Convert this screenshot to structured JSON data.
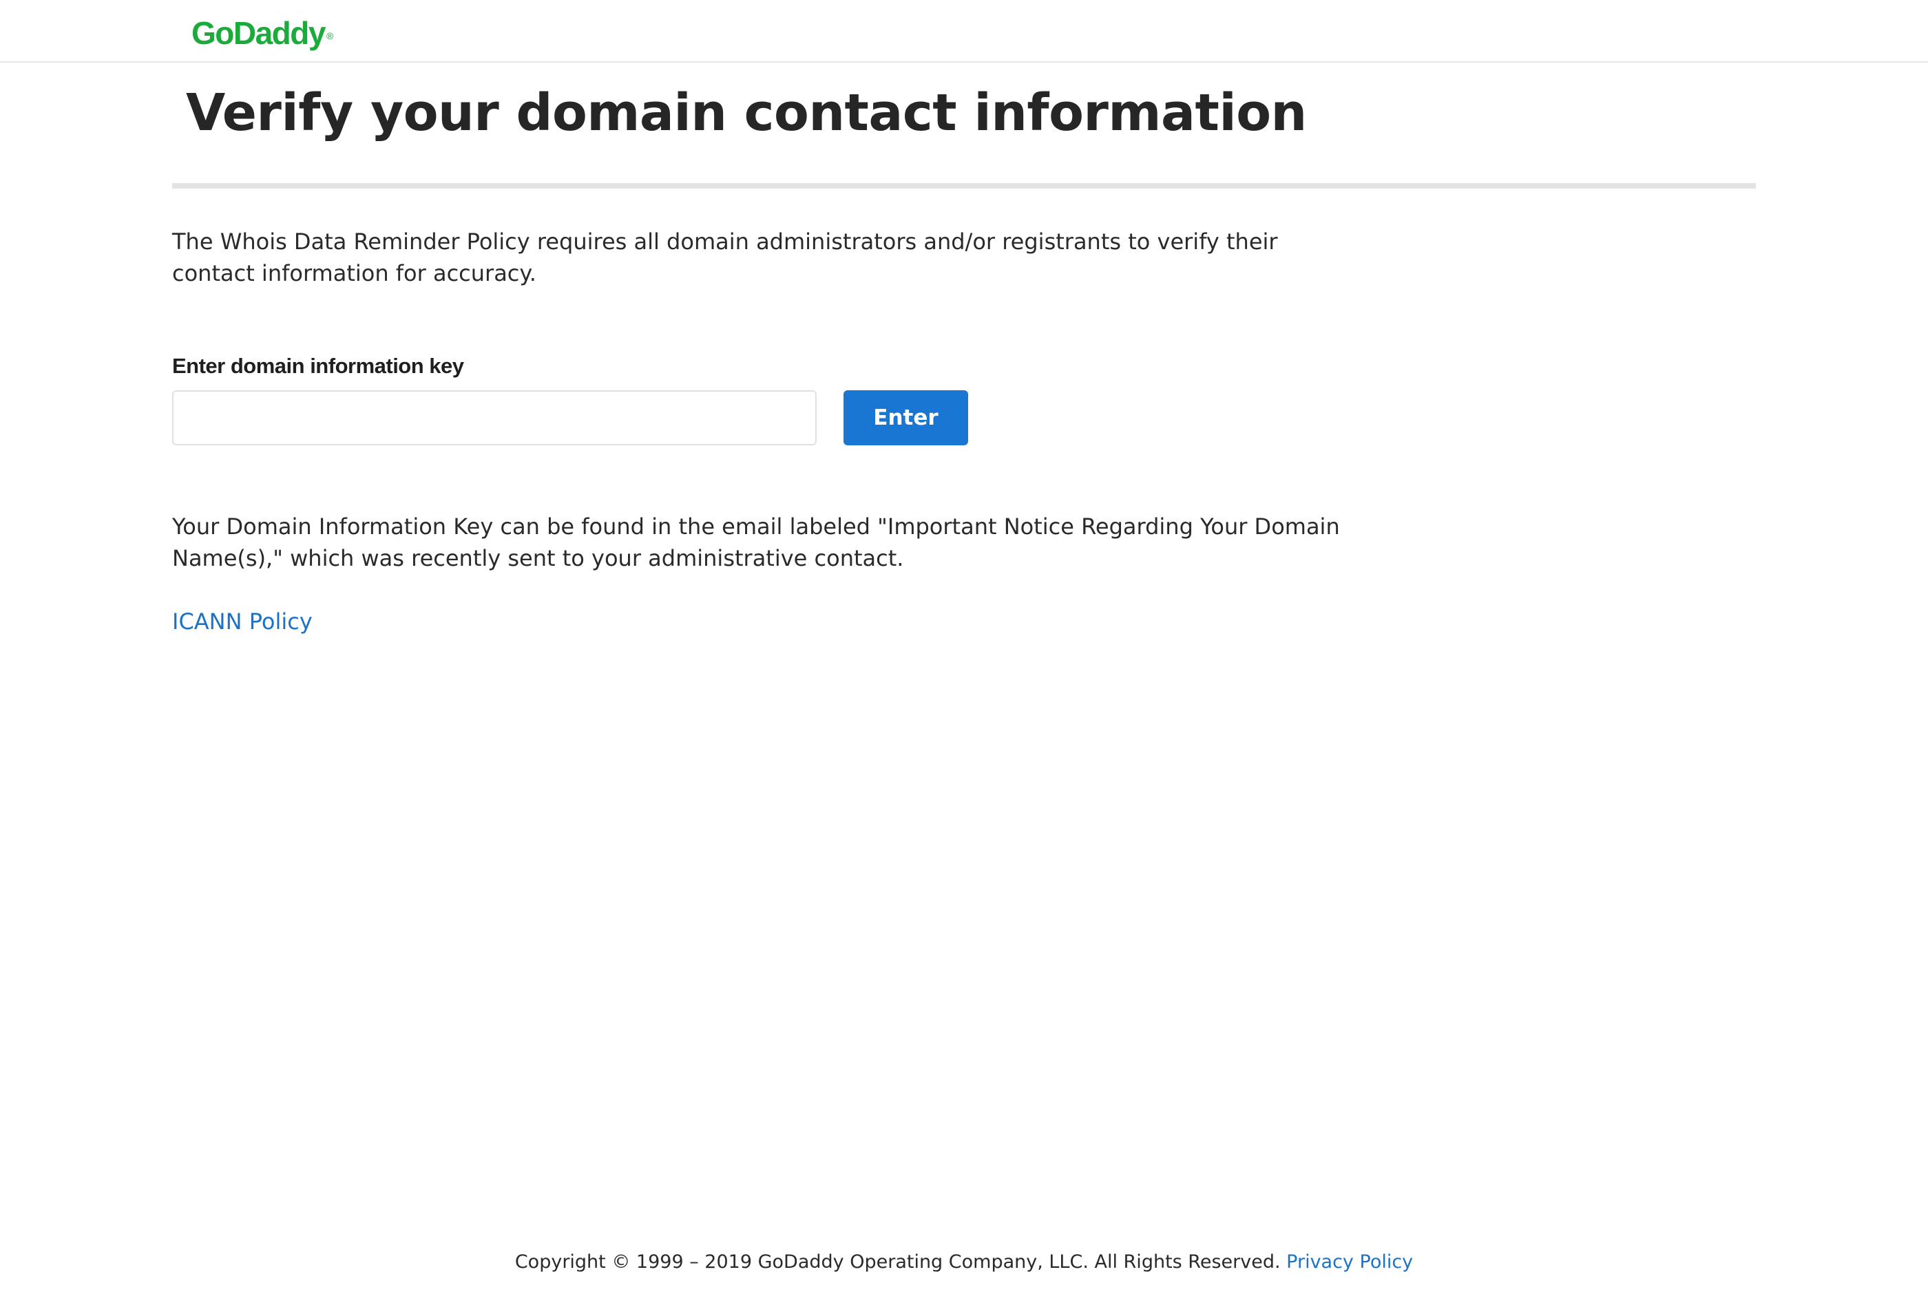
{
  "header": {
    "logo_text": "GoDaddy",
    "logo_mark": "®"
  },
  "main": {
    "title": "Verify your domain contact information",
    "intro": "The Whois Data Reminder Policy requires all domain administrators and/or registrants to verify their contact information for accuracy.",
    "key_field": {
      "label": "Enter domain information key",
      "value": "",
      "placeholder": ""
    },
    "enter_button_label": "Enter",
    "key_help": "Your Domain Information Key can be found in the email labeled \"Important Notice Regarding Your Domain Name(s),\" which was recently sent to your administrative contact.",
    "icann_link_label": "ICANN Policy"
  },
  "footer": {
    "copyright": "Copyright © 1999 – 2019 GoDaddy Operating Company, LLC. All Rights Reserved.",
    "privacy_link_label": "Privacy Policy"
  },
  "colors": {
    "brand_green": "#1bab3a",
    "button_blue": "#1976d2",
    "link_blue": "#1a73c8"
  }
}
